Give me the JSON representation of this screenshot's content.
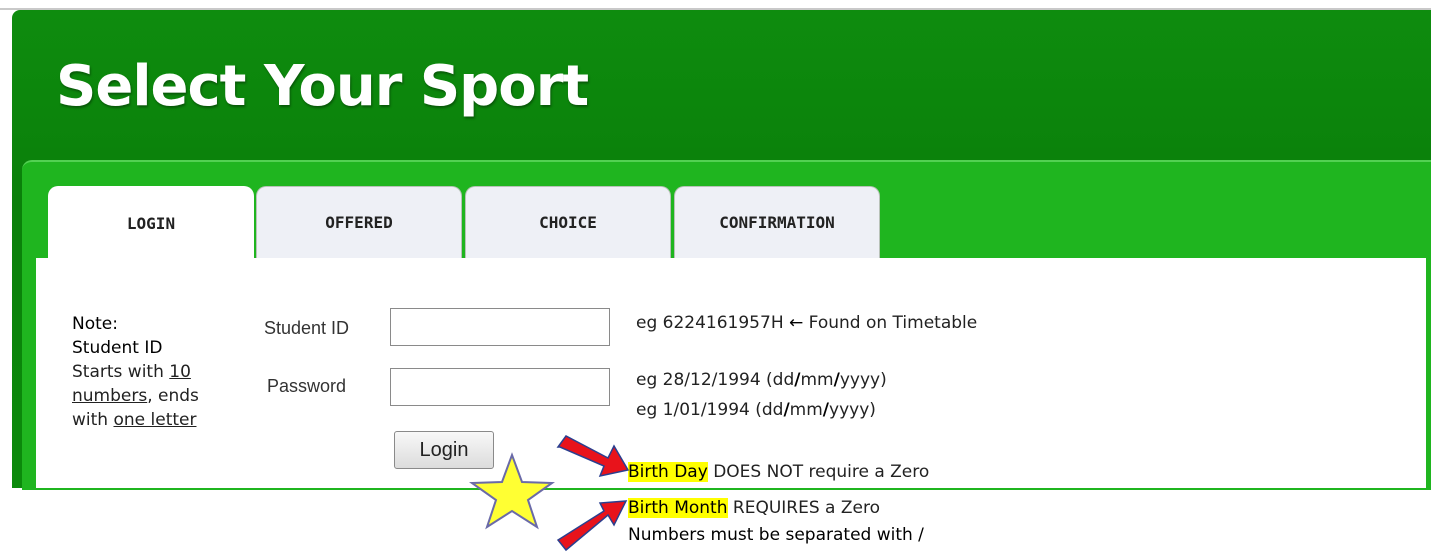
{
  "header": {
    "title": "Select Your Sport"
  },
  "tabs": [
    {
      "label": "LOGIN",
      "active": true
    },
    {
      "label": "OFFERED",
      "active": false
    },
    {
      "label": "CHOICE",
      "active": false
    },
    {
      "label": "CONFIRMATION",
      "active": false
    }
  ],
  "note": {
    "heading": "Note:",
    "subject": "Student ID",
    "line1_a": "Starts with ",
    "line1_b": "10",
    "line2_a": "numbers",
    "line2_b": ", ends",
    "line3_a": "with ",
    "line3_b": "one letter"
  },
  "form": {
    "student_id_label": "Student ID",
    "student_id_value": "",
    "password_label": "Password",
    "password_value": "",
    "login_button": "Login"
  },
  "hints": {
    "student_id_example": "eg 6224161957H ",
    "arrow": "←",
    "student_id_found": " Found on Timetable",
    "pw1_pre": "eg 28/12/1994 (dd",
    "pw1_mm": "mm",
    "pw1_yyyy": "yyyy)",
    "pw2_pre": "eg 1/01/1994 (dd",
    "pw2_mm": "mm",
    "pw2_yyyy": "yyyy)",
    "slash": "/",
    "day_bold": "Birth Day",
    "day_rest": " DOES NOT require a Zero",
    "month_bold": "Birth Month",
    "month_rest": " REQUIRES a Zero",
    "separator": "Numbers must be separated with /"
  },
  "colors": {
    "header_green": "#0a7f0a",
    "panel_green": "#1fb51f",
    "highlight": "#ffff00",
    "arrow_red": "#e8131b",
    "star_yellow": "#ffff33"
  }
}
